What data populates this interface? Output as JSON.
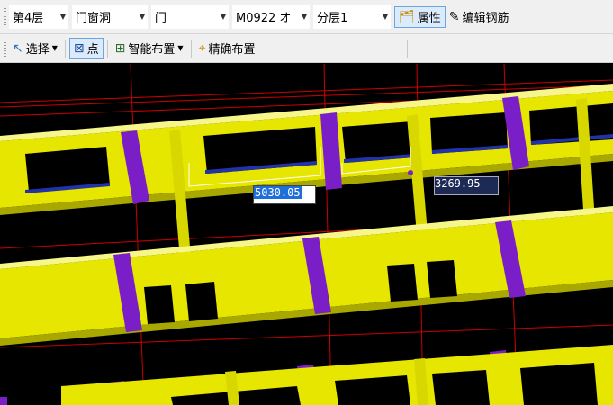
{
  "toolbar1": {
    "floor": "第4层",
    "category": "门窗洞",
    "component_type": "门",
    "component_name": "M0922 オ",
    "sublayer": "分层1",
    "properties_label": "属性",
    "edit_rebar_label": "编辑钢筋"
  },
  "toolbar2": {
    "select_label": "选择",
    "point_label": "点",
    "smart_layout_label": "智能布置",
    "precise_layout_label": "精确布置"
  },
  "viewport": {
    "dimension_input_1": "5030.05",
    "dimension_input_2": "3269.95",
    "colors": {
      "background": "#000000",
      "wall": "#e6e600",
      "column": "#7a1fc8",
      "axis_line": "#cc0000"
    }
  }
}
